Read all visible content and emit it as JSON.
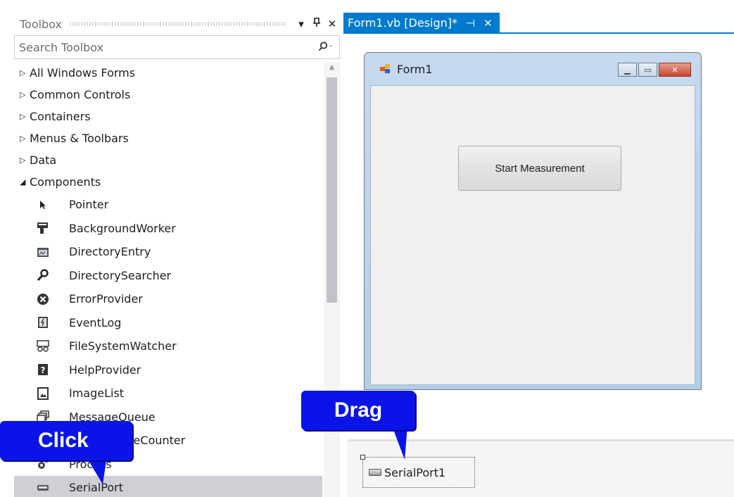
{
  "toolbox": {
    "title": "Toolbox",
    "controls": {
      "dropdown": "▾",
      "pin": "ᵾ",
      "close": "✕"
    },
    "search_placeholder": "Search Toolbox",
    "categories": [
      {
        "label": "All Windows Forms",
        "expanded": false
      },
      {
        "label": "Common Controls",
        "expanded": false
      },
      {
        "label": "Containers",
        "expanded": false
      },
      {
        "label": "Menus & Toolbars",
        "expanded": false
      },
      {
        "label": "Data",
        "expanded": false
      },
      {
        "label": "Components",
        "expanded": true
      }
    ],
    "items": [
      {
        "label": "Pointer",
        "icon": "pointer-icon"
      },
      {
        "label": "BackgroundWorker",
        "icon": "background-worker-icon"
      },
      {
        "label": "DirectoryEntry",
        "icon": "directory-entry-icon"
      },
      {
        "label": "DirectorySearcher",
        "icon": "directory-searcher-icon"
      },
      {
        "label": "ErrorProvider",
        "icon": "error-provider-icon"
      },
      {
        "label": "EventLog",
        "icon": "event-log-icon"
      },
      {
        "label": "FileSystemWatcher",
        "icon": "file-system-watcher-icon"
      },
      {
        "label": "HelpProvider",
        "icon": "help-provider-icon"
      },
      {
        "label": "ImageList",
        "icon": "image-list-icon"
      },
      {
        "label": "MessageQueue",
        "icon": "message-queue-icon"
      },
      {
        "label": "PerformanceCounter",
        "icon": "performance-counter-icon"
      },
      {
        "label": "Process",
        "icon": "process-icon"
      },
      {
        "label": "SerialPort",
        "icon": "serial-port-icon",
        "selected": true
      }
    ]
  },
  "designer": {
    "tab_title": "Form1.vb [Design]*",
    "tab_pin": "⊣",
    "tab_close": "✕",
    "form_title": "Form1",
    "button_label": "Start Measurement",
    "tray_component": "SerialPort1"
  },
  "annotations": {
    "drag": "Drag",
    "click": "Click"
  },
  "colors": {
    "accent": "#007acc",
    "callout": "#0a14e8",
    "selection": "#cfcfd6"
  }
}
